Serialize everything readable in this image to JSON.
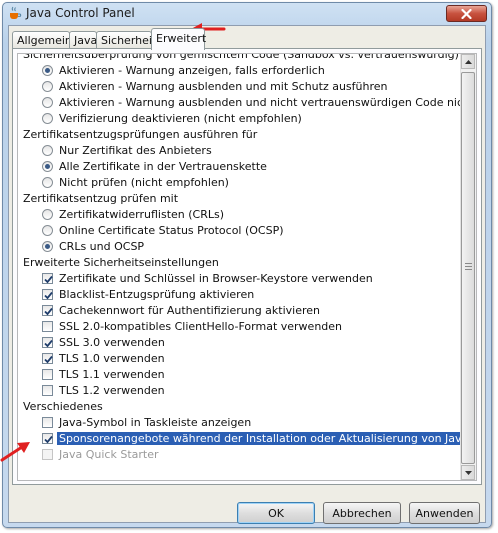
{
  "window": {
    "title": "Java Control Panel"
  },
  "tabs": [
    {
      "label": "Allgemein",
      "active": false
    },
    {
      "label": "Java",
      "active": false
    },
    {
      "label": "Sicherheit",
      "active": false
    },
    {
      "label": "Erweitert",
      "active": true
    }
  ],
  "sections": [
    {
      "header": "Sicherheitsüberprüfung von gemischtem Code (Sandbox vs. vertrauenswürdig)",
      "type": "radio",
      "options": [
        {
          "label": "Aktivieren - Warnung anzeigen, falls erforderlich",
          "checked": true
        },
        {
          "label": "Aktivieren - Warnung ausblenden und mit Schutz ausführen",
          "checked": false
        },
        {
          "label": "Aktivieren - Warnung ausblenden und nicht vertrauenswürdigen Code nicht ausführen",
          "checked": false
        },
        {
          "label": "Verifizierung deaktivieren (nicht empfohlen)",
          "checked": false
        }
      ]
    },
    {
      "header": "Zertifikatsentzugsprüfungen ausführen für",
      "type": "radio",
      "options": [
        {
          "label": "Nur Zertifikat des Anbieters",
          "checked": false
        },
        {
          "label": "Alle Zertifikate in der Vertrauenskette",
          "checked": true
        },
        {
          "label": "Nicht prüfen (nicht empfohlen)",
          "checked": false
        }
      ]
    },
    {
      "header": "Zertifikatsentzug prüfen mit",
      "type": "radio",
      "options": [
        {
          "label": "Zertifikatwiderruflisten (CRLs)",
          "checked": false
        },
        {
          "label": "Online Certificate Status Protocol (OCSP)",
          "checked": false
        },
        {
          "label": "CRLs und OCSP",
          "checked": true
        }
      ]
    },
    {
      "header": "Erweiterte Sicherheitseinstellungen",
      "type": "check",
      "options": [
        {
          "label": "Zertifikate und Schlüssel in Browser-Keystore verwenden",
          "checked": true
        },
        {
          "label": "Blacklist-Entzugsprüfung aktivieren",
          "checked": true
        },
        {
          "label": "Cachekennwort für Authentifizierung aktivieren",
          "checked": true
        },
        {
          "label": "SSL 2.0-kompatibles ClientHello-Format verwenden",
          "checked": false
        },
        {
          "label": "SSL 3.0 verwenden",
          "checked": true
        },
        {
          "label": "TLS 1.0 verwenden",
          "checked": true
        },
        {
          "label": "TLS 1.1 verwenden",
          "checked": false
        },
        {
          "label": "TLS 1.2 verwenden",
          "checked": false
        }
      ]
    },
    {
      "header": "Verschiedenes",
      "type": "check",
      "options": [
        {
          "label": "Java-Symbol in Taskleiste anzeigen",
          "checked": false
        },
        {
          "label": "Sponsorenangebote während der Installation oder Aktualisierung von Java unterdrücken",
          "checked": true,
          "highlight": true
        },
        {
          "label": "Java Quick Starter",
          "checked": false,
          "disabled": true
        }
      ]
    }
  ],
  "buttons": {
    "ok": "OK",
    "cancel": "Abbrechen",
    "apply": "Anwenden"
  },
  "colors": {
    "annotation_arrow": "#e02020",
    "selection": "#2b5fb4"
  }
}
